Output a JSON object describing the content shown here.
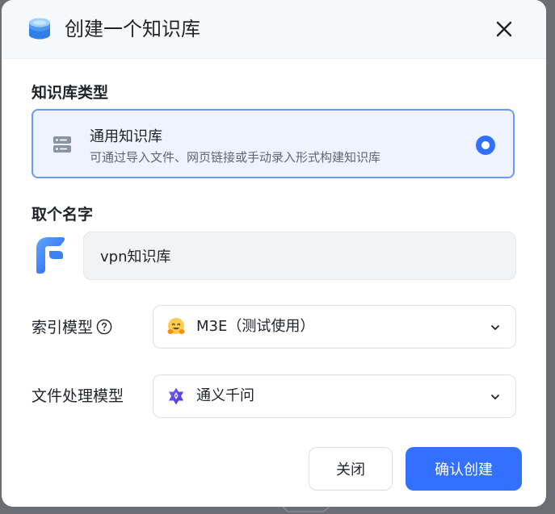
{
  "dialog": {
    "title": "创建一个知识库",
    "header_icon": "database-stack-icon",
    "close_icon": "close-icon"
  },
  "kb_type": {
    "label": "知识库类型",
    "option": {
      "title": "通用知识库",
      "description": "可通过导入文件、网页链接或手动录入形式构建知识库",
      "icon": "server-icon",
      "selected": true
    }
  },
  "name": {
    "label": "取个名字",
    "value": "vpn知识库",
    "avatar_icon": "knowledge-base-logo-icon"
  },
  "index_model": {
    "label": "索引模型",
    "help_icon": "question-circle-icon",
    "value": "M3E（测试使用）",
    "icon": "hugging-face-emoji-icon"
  },
  "file_model": {
    "label": "文件处理模型",
    "value": "通义千问",
    "icon": "qwen-logo-icon"
  },
  "actions": {
    "cancel": "关闭",
    "confirm": "确认创建"
  },
  "colors": {
    "primary": "#3370ff",
    "selected_border": "#6b9af6",
    "selected_bg": "#eff3fe"
  }
}
